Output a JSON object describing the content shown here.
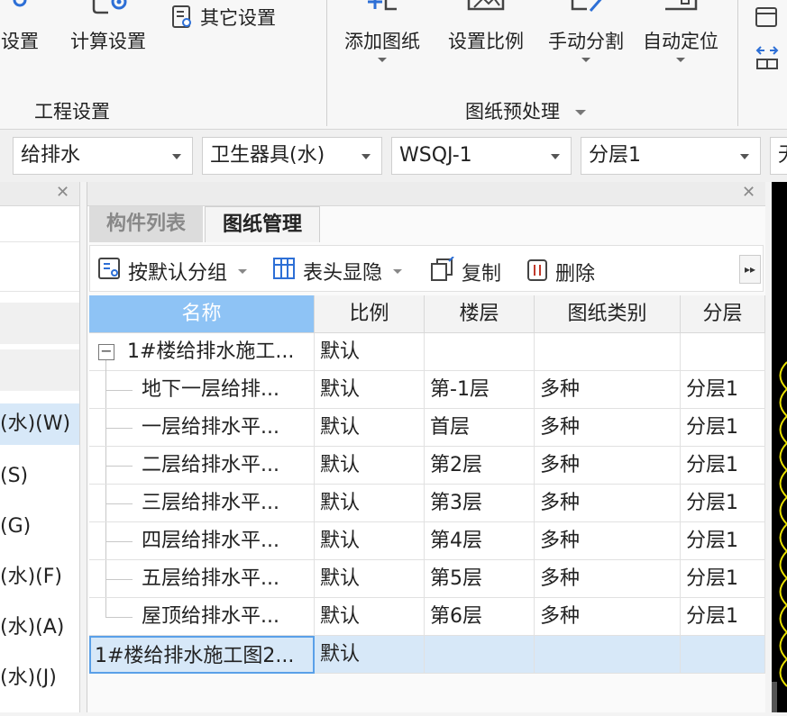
{
  "ribbon": {
    "buttons": [
      {
        "label": "设置",
        "icon": "settings-icon"
      },
      {
        "label": "计算设置",
        "icon": "calc-settings-icon"
      },
      {
        "label": "其它设置",
        "icon": "other-settings-icon"
      },
      {
        "label": "添加图纸",
        "icon": "add-drawing-icon"
      },
      {
        "label": "设置比例",
        "icon": "scale-icon"
      },
      {
        "label": "手动分割",
        "icon": "manual-split-icon"
      },
      {
        "label": "自动定位",
        "icon": "auto-locate-icon"
      }
    ],
    "groups": {
      "project": "工程设置",
      "drawing": "图纸预处理"
    }
  },
  "dropdowns": [
    "给排水",
    "卫生器具(水)",
    "WSQJ-1",
    "分层1",
    "无"
  ],
  "left_panel": {
    "items": [
      "(水)(W)",
      "(S)",
      "(G)",
      "(水)(F)",
      "(水)(A)",
      "(水)(J)"
    ]
  },
  "right_panel": {
    "tabs": {
      "component_list": "构件列表",
      "drawing_manage": "图纸管理"
    },
    "toolbar": {
      "group": "按默认分组",
      "header": "表头显隐",
      "copy": "复制",
      "delete": "删除"
    },
    "columns": [
      "名称",
      "比例",
      "楼层",
      "图纸类别",
      "分层"
    ],
    "parent_row": {
      "name": "1#楼给排水施工...",
      "scale": "默认"
    },
    "rows": [
      {
        "name": "地下一层给排...",
        "scale": "默认",
        "floor": "第-1层",
        "category": "多种",
        "layer": "分层1"
      },
      {
        "name": "一层给排水平...",
        "scale": "默认",
        "floor": "首层",
        "category": "多种",
        "layer": "分层1"
      },
      {
        "name": "二层给排水平...",
        "scale": "默认",
        "floor": "第2层",
        "category": "多种",
        "layer": "分层1"
      },
      {
        "name": "三层给排水平...",
        "scale": "默认",
        "floor": "第3层",
        "category": "多种",
        "layer": "分层1"
      },
      {
        "name": "四层给排水平...",
        "scale": "默认",
        "floor": "第4层",
        "category": "多种",
        "layer": "分层1"
      },
      {
        "name": "五层给排水平...",
        "scale": "默认",
        "floor": "第5层",
        "category": "多种",
        "layer": "分层1"
      },
      {
        "name": "屋顶给排水平...",
        "scale": "默认",
        "floor": "第6层",
        "category": "多种",
        "layer": "分层1"
      }
    ],
    "selected_row": {
      "name": "1#楼给排水施工图2...",
      "scale": "默认"
    }
  },
  "colors": {
    "header_selected": "#8ec3f5",
    "row_selected": "#d7e8f8",
    "cad_line": "#e8e000"
  }
}
